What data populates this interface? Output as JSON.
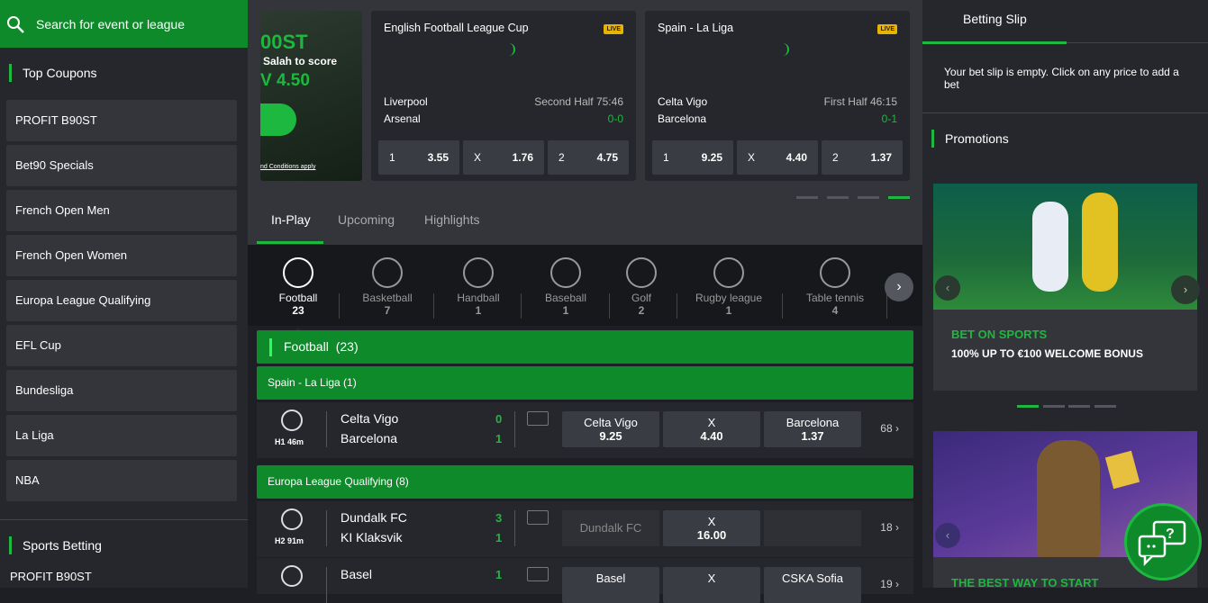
{
  "search": {
    "placeholder": "Search for event or league"
  },
  "sidebar": {
    "top_coupons_title": "Top Coupons",
    "coupons": [
      "PROFIT B90ST",
      "Bet90 Specials",
      "French Open Men",
      "French Open Women",
      "Europa League Qualifying",
      "EFL Cup",
      "Bundesliga",
      "La Liga",
      "NBA"
    ],
    "sports_betting_title": "Sports Betting",
    "sports_betting_first": "PROFIT B90ST"
  },
  "banner": {
    "boost": "00ST",
    "line": "Salah to score",
    "odds": "V 4.50",
    "terms": "nd Conditions apply"
  },
  "featured": [
    {
      "league": "English Football League Cup",
      "live": "LIVE",
      "home": "Liverpool",
      "away": "Arsenal",
      "period": "Second Half 75:46",
      "score": "0-0",
      "odds": [
        {
          "l": "1",
          "v": "3.55"
        },
        {
          "l": "X",
          "v": "1.76"
        },
        {
          "l": "2",
          "v": "4.75"
        }
      ]
    },
    {
      "league": "Spain - La Liga",
      "live": "LIVE",
      "home": "Celta Vigo",
      "away": "Barcelona",
      "period": "First Half 46:15",
      "score": "0-1",
      "odds": [
        {
          "l": "1",
          "v": "9.25"
        },
        {
          "l": "X",
          "v": "4.40"
        },
        {
          "l": "2",
          "v": "1.37"
        }
      ]
    }
  ],
  "tabs": [
    "In-Play",
    "Upcoming",
    "Highlights"
  ],
  "sports": [
    {
      "name": "Football",
      "count": "23"
    },
    {
      "name": "Basketball",
      "count": "7"
    },
    {
      "name": "Handball",
      "count": "1"
    },
    {
      "name": "Baseball",
      "count": "1"
    },
    {
      "name": "Golf",
      "count": "2"
    },
    {
      "name": "Rugby league",
      "count": "1"
    },
    {
      "name": "Table tennis",
      "count": "4"
    }
  ],
  "section": {
    "title": "Football",
    "count": "(23)"
  },
  "leagues": [
    {
      "name": "Spain - La Liga (1)"
    },
    {
      "name": "Europa League Qualifying (8)"
    }
  ],
  "matches": [
    {
      "time": "H1  46m",
      "home": "Celta Vigo",
      "away": "Barcelona",
      "hs": "0",
      "as": "1",
      "o1n": "Celta Vigo",
      "o1": "9.25",
      "oxn": "X",
      "ox": "4.40",
      "o2n": "Barcelona",
      "o2": "1.37",
      "more": "68"
    },
    {
      "time": "H2  91m",
      "home": "Dundalk FC",
      "away": "KI Klaksvik",
      "hs": "3",
      "as": "1",
      "o1n": "Dundalk FC",
      "oxn": "X",
      "ox": "16.00",
      "more": "18"
    },
    {
      "home": "Basel",
      "hs": "1",
      "o1n": "Basel",
      "oxn": "X",
      "o2n": "CSKA Sofia",
      "more": "19"
    }
  ],
  "slip": {
    "title": "Betting Slip",
    "empty": "Your bet slip is empty. Click on any price to add a bet"
  },
  "promotions": {
    "title": "Promotions",
    "p1_head": "BET ON SPORTS",
    "p1_sub": "100% UP TO €100 WELCOME BONUS",
    "p2_head": "THE BEST WAY TO START"
  },
  "colors": {
    "green": "#0f8a2b",
    "accent": "#1db83f",
    "live": "#e8b400"
  }
}
